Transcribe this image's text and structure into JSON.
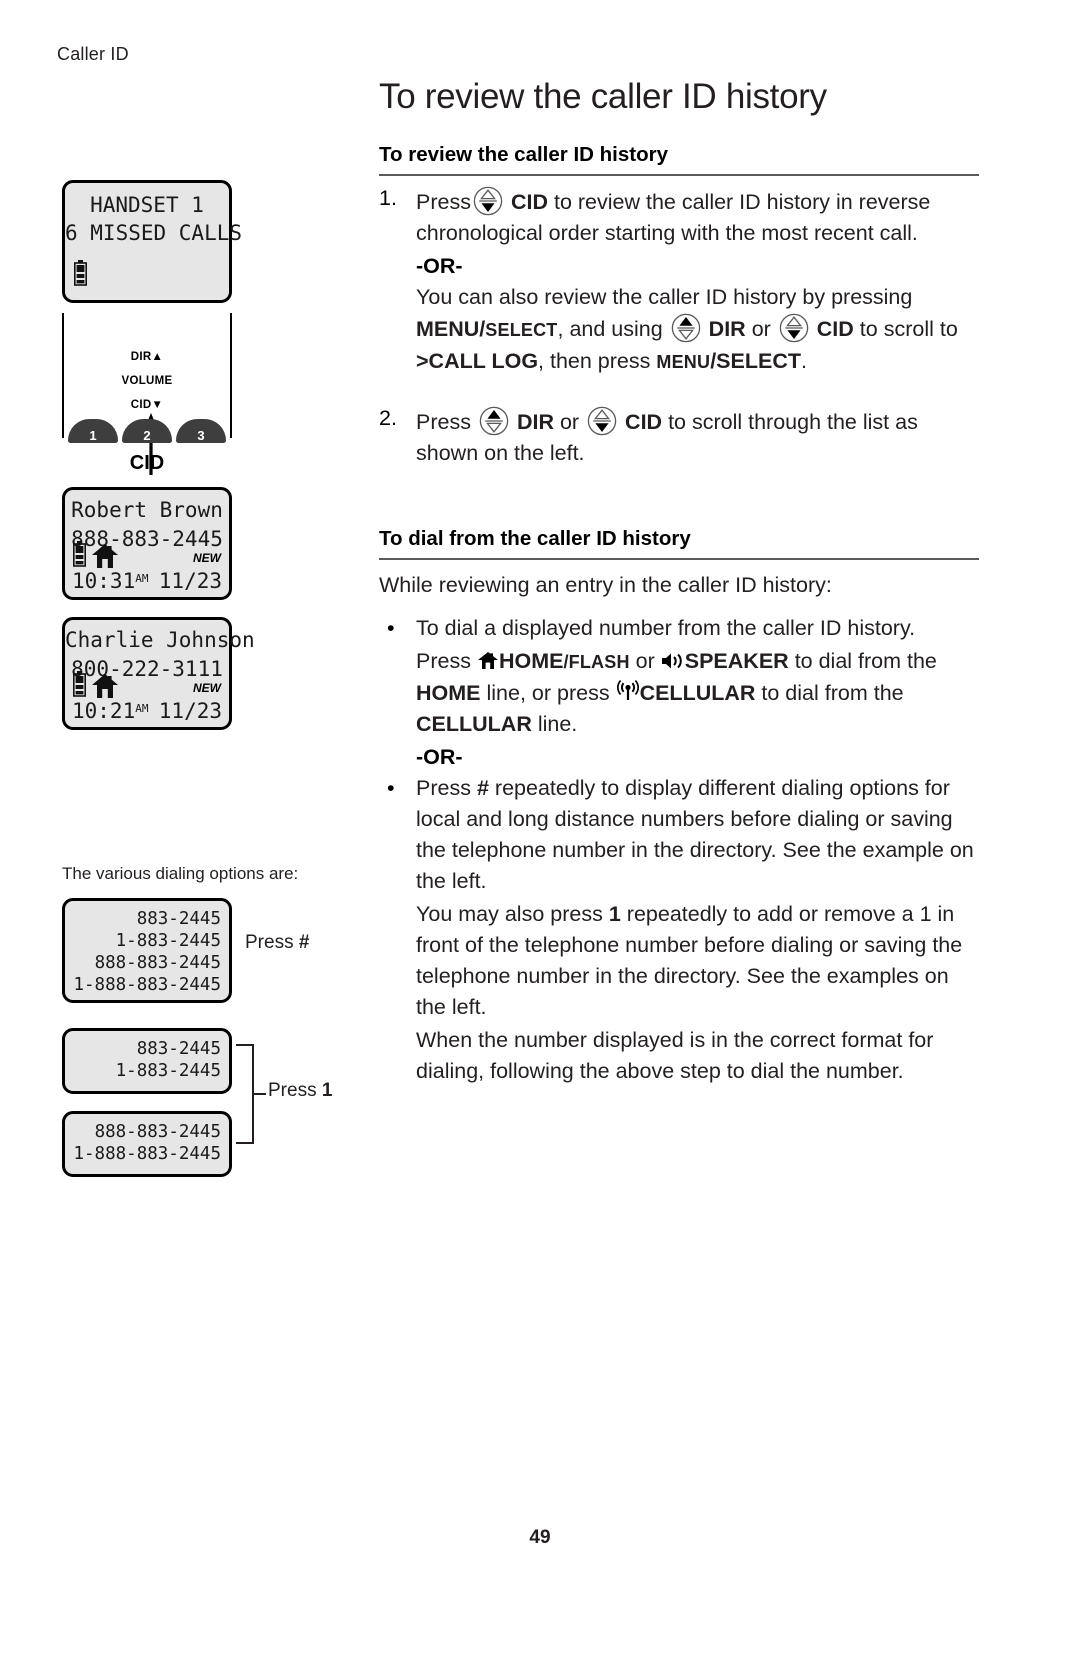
{
  "running_header": "Caller ID",
  "page_number": "49",
  "chapter_title": "To review the caller ID history",
  "sections": {
    "review": {
      "heading": "To review the caller ID history",
      "step1_num": "1.",
      "step1_a": "Press",
      "step1_cid": "CID",
      "step1_b": "to review the caller ID history in reverse chronological order starting with the most recent call.",
      "or": "-OR-",
      "alt_a": "You can also review the caller ID history by pressing",
      "alt_menu": "MENU/",
      "alt_select": "SELECT",
      "alt_b": ", and using",
      "alt_dir": "DIR",
      "alt_or": "or",
      "alt_cid": "CID",
      "alt_c": "to scroll to",
      "alt_calllog": ">CALL LOG",
      "alt_d": ", then press",
      "alt_menu2": "MENU",
      "alt_select2": "/SELECT",
      "alt_period": ".",
      "step2_num": "2.",
      "step2_a": "Press",
      "step2_dir": "DIR",
      "step2_or": "or",
      "step2_cid": "CID",
      "step2_b": "to scroll through the list as shown on the left."
    },
    "dial": {
      "heading": "To dial from the caller ID history",
      "intro": "While reviewing an entry in the caller ID history:",
      "bullet1": "To dial a displayed number from the caller ID history.",
      "press_a": "Press",
      "home_flash_bold": "HOME",
      "home_flash_sc": "/FLASH",
      "press_or": "or",
      "speaker": "SPEAKER",
      "press_b": "to dial from the",
      "home_word": "HOME",
      "press_c": "line, or press",
      "cellular": "CELLULAR",
      "press_d": "to dial from the",
      "cellular_word": "CELLULAR",
      "press_e": "line.",
      "or": "-OR-",
      "bullet2_a": "Press",
      "bullet2_hash": "#",
      "bullet2_b": "repeatedly to display different dialing options for local and long distance numbers before dialing or saving the telephone number in the directory. See the example on the left.",
      "para_a": "You may also press",
      "para_one": "1",
      "para_b": "repeatedly to add or remove a 1 in front of the telephone number before dialing or saving the telephone number in the directory. See the examples on the left.",
      "para_final": "When the number displayed is in the correct format for dialing, following the above step to dial the number."
    }
  },
  "lcd": {
    "handset": {
      "line1": "HANDSET 1",
      "line2": "6 MISSED CALLS"
    },
    "entry1": {
      "name": "Robert Brown",
      "number": "888-883-2445",
      "new": "NEW",
      "time": "10:31",
      "ampm": "AM",
      "date": "11/23"
    },
    "entry2": {
      "name": "Charlie Johnson",
      "number": "800-222-3111",
      "new": "NEW",
      "time": "10:21",
      "ampm": "AM",
      "date": "11/23"
    }
  },
  "keypad": {
    "dir_label": "DIR",
    "volume_label": "VOLUME",
    "cid_label": "CID",
    "cid_caption": "CID",
    "key1": "1",
    "key2": "2",
    "key3": "3"
  },
  "dialing_options": {
    "caption": "The various dialing options are:",
    "press_hash_prefix": "Press",
    "press_hash_key": "#",
    "press_one_prefix": "Press",
    "press_one_key": "1",
    "screen_hash": [
      "883-2445",
      "1-883-2445",
      "888-883-2445",
      "1-888-883-2445"
    ],
    "screen_one_a": [
      "883-2445",
      "1-883-2445"
    ],
    "screen_one_b": [
      "888-883-2445",
      "1-888-883-2445"
    ]
  },
  "icons": {
    "cid_key": "cid-nav-key-icon",
    "dir_key": "dir-nav-key-icon",
    "house": "house-icon",
    "speaker": "speaker-icon",
    "antenna": "cellular-antenna-icon",
    "battery": "battery-icon"
  },
  "colors": {
    "text": "#231f20",
    "rule": "#58595b",
    "lcd_bg": "#e6e6e6",
    "key_fill": "#3e3e3e"
  }
}
